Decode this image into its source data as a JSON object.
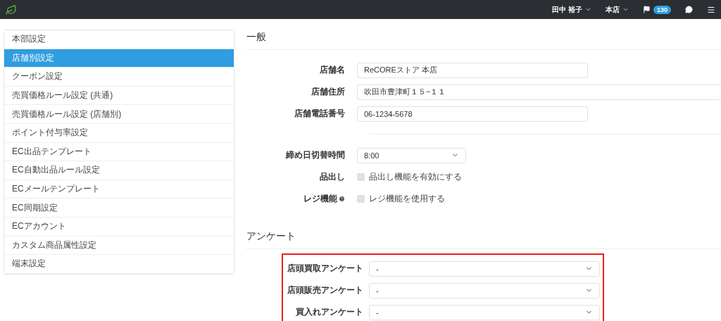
{
  "topbar": {
    "user": "田中 裕子",
    "store": "本店",
    "notifications": "130"
  },
  "sidebar": {
    "items": [
      {
        "label": "本部設定",
        "selected": false
      },
      {
        "label": "店舗別設定",
        "selected": true
      },
      {
        "label": "クーポン設定",
        "selected": false
      },
      {
        "label": "売買価格ルール設定 (共通)",
        "selected": false
      },
      {
        "label": "売買価格ルール設定 (店舗別)",
        "selected": false
      },
      {
        "label": "ポイント付与率設定",
        "selected": false
      },
      {
        "label": "EC出品テンプレート",
        "selected": false
      },
      {
        "label": "EC自動出品ルール設定",
        "selected": false
      },
      {
        "label": "ECメールテンプレート",
        "selected": false
      },
      {
        "label": "EC同期設定",
        "selected": false
      },
      {
        "label": "ECアカウント",
        "selected": false
      },
      {
        "label": "カスタム商品属性設定",
        "selected": false
      },
      {
        "label": "端末設定",
        "selected": false
      }
    ]
  },
  "general": {
    "title": "一般",
    "fields": [
      {
        "label": "店舗名",
        "value": "ReCOREストア 本店",
        "wide": false
      },
      {
        "label": "店舗住所",
        "value": "吹田市豊津町１５−１１",
        "wide": true
      },
      {
        "label": "店舗電話番号",
        "value": "06-1234-5678",
        "wide": false
      }
    ],
    "settings": [
      {
        "kind": "select",
        "label": "締め日切替時間",
        "value": "8:00"
      },
      {
        "kind": "checkbox",
        "label": "品出し",
        "text": "品出し機能を有効にする",
        "checked": false,
        "help": false
      },
      {
        "kind": "checkbox",
        "label": "レジ機能",
        "text": "レジ機能を使用する",
        "checked": false,
        "help": true
      }
    ]
  },
  "survey": {
    "title": "アンケート",
    "highlighted": true,
    "selects": [
      {
        "label": "店頭買取アンケート",
        "value": "-"
      },
      {
        "label": "店頭販売アンケート",
        "value": "-"
      },
      {
        "label": "買入れアンケート",
        "value": "-"
      }
    ]
  }
}
